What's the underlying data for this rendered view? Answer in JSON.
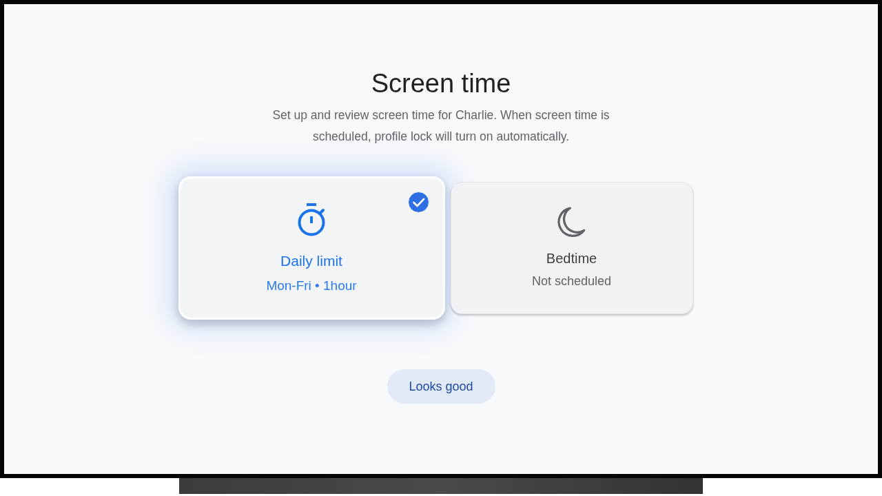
{
  "screen": {
    "title": "Screen time",
    "description": "Set up and review screen time for Charlie. When screen time is scheduled, profile lock will turn on automatically."
  },
  "options": [
    {
      "kind": "daily_limit",
      "title": "Daily limit",
      "subtitle": "Mon-Fri • 1hour",
      "selected": true
    },
    {
      "kind": "bedtime",
      "title": "Bedtime",
      "subtitle": "Not scheduled",
      "selected": false
    }
  ],
  "button": {
    "label": "Looks good"
  }
}
